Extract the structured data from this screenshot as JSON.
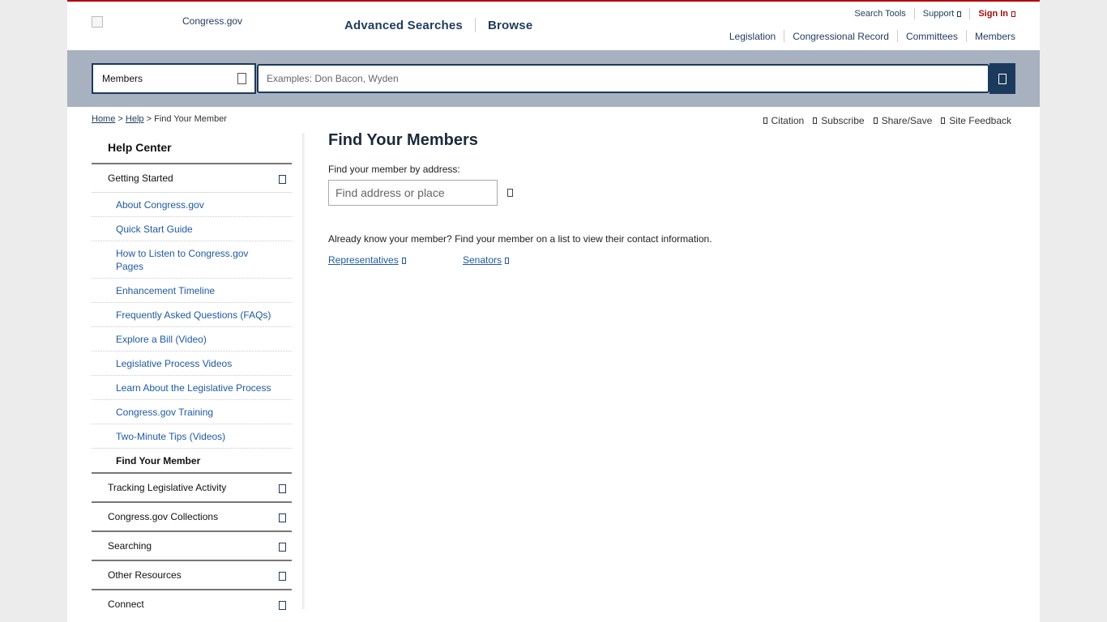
{
  "logo": {
    "alt": "Congress.gov"
  },
  "main_nav": [
    "Advanced Searches",
    "Browse"
  ],
  "utility": {
    "search_tools": "Search Tools",
    "support": "Support",
    "sign_in": "Sign In"
  },
  "secondary_nav": [
    "Legislation",
    "Congressional Record",
    "Committees",
    "Members"
  ],
  "search": {
    "scope": "Members",
    "placeholder": "Examples: Don Bacon, Wyden"
  },
  "breadcrumb": {
    "home": "Home",
    "sep1": ">",
    "help": "Help",
    "sep2": ">",
    "current": "Find Your Member"
  },
  "tools": [
    "Citation",
    "Subscribe",
    "Share/Save",
    "Site Feedback"
  ],
  "sidebar": {
    "title": "Help Center",
    "getting_started": "Getting Started",
    "sub_items": [
      "About Congress.gov",
      "Quick Start Guide",
      "How to Listen to Congress.gov Pages",
      "Enhancement Timeline",
      "Frequently Asked Questions (FAQs)",
      "Explore a Bill (Video)",
      "Legislative Process Videos",
      "Learn About the Legislative Process",
      "Congress.gov Training",
      "Two-Minute Tips (Videos)",
      "Find Your Member"
    ],
    "sections": [
      "Tracking Legislative Activity",
      "Congress.gov Collections",
      "Searching",
      "Other Resources",
      "Connect"
    ]
  },
  "main": {
    "title": "Find Your Members",
    "address_label": "Find your member by address:",
    "address_placeholder": "Find address or place",
    "know_text": "Already know your member? Find your member on a list to view their contact information.",
    "representatives": "Representatives",
    "senators": "Senators"
  },
  "colors": {
    "accent_red": "#b20a0a",
    "navy": "#1b3a5c",
    "search_band": "#a8b1bf",
    "link_blue": "#1f5aa0"
  }
}
